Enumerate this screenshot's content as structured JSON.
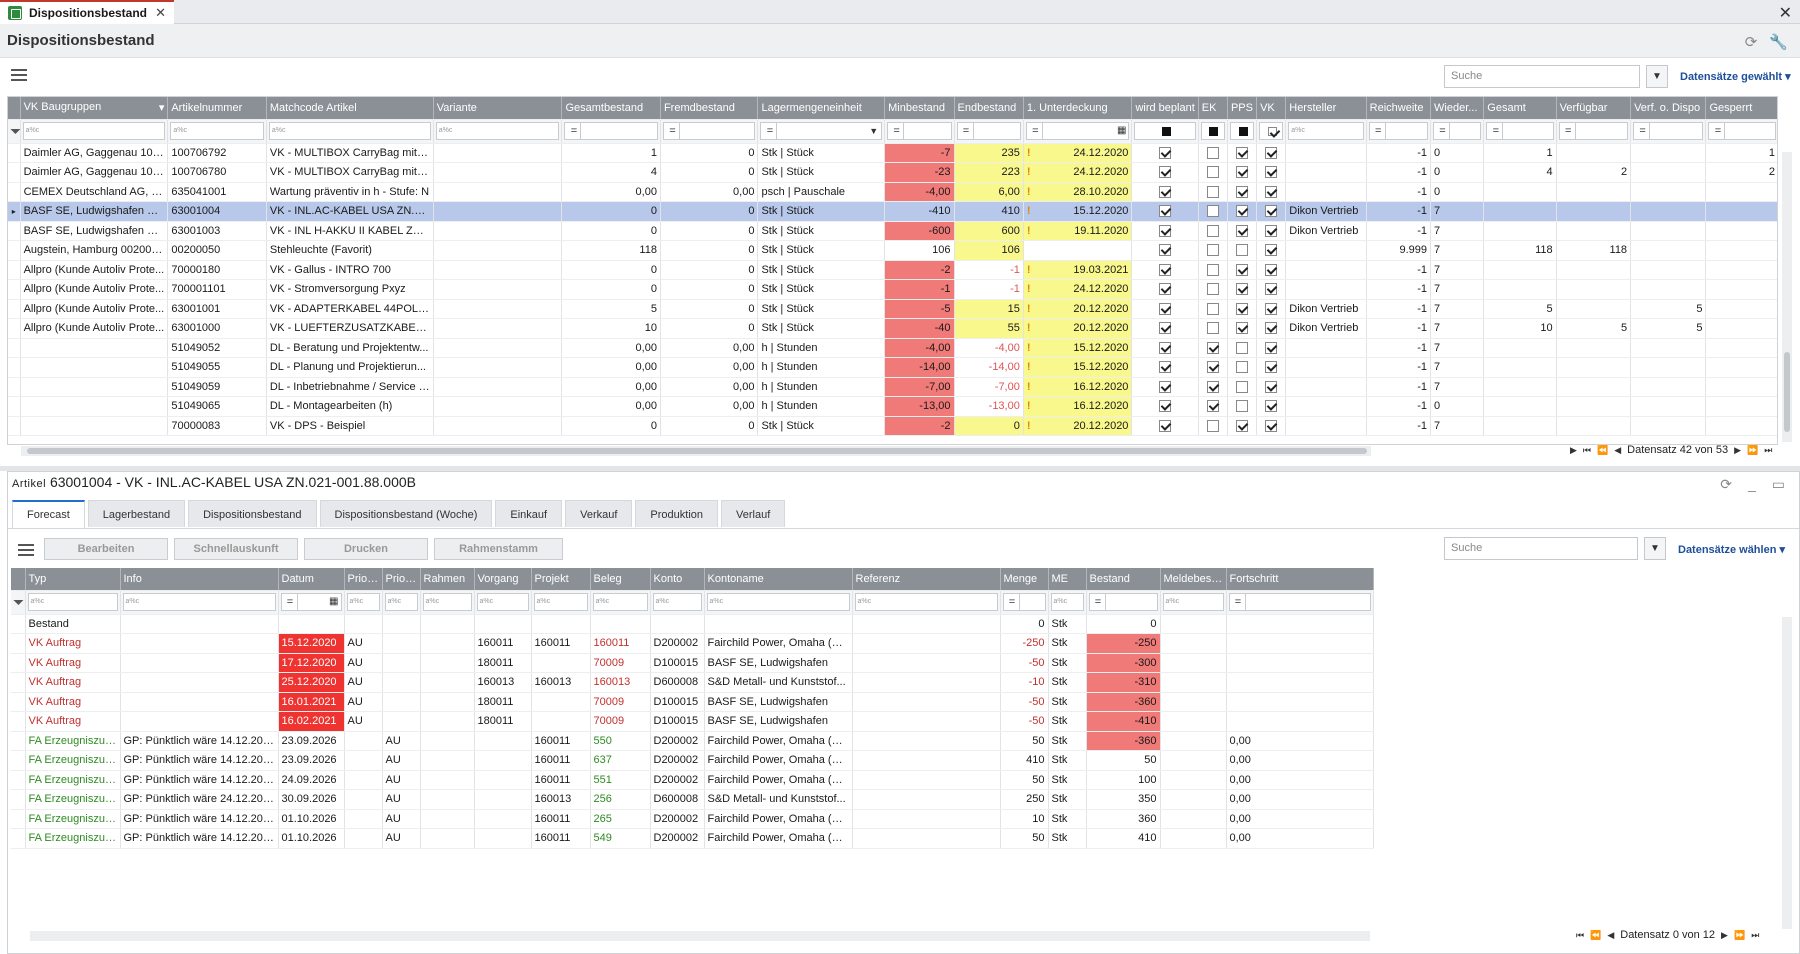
{
  "tab": {
    "label": "Dispositionsbestand",
    "close": "✕"
  },
  "window": {
    "title": "Dispositionsbestand",
    "close": "✕"
  },
  "top": {
    "search_placeholder": "Suche",
    "datasets_link": "Datensätze gewählt",
    "columns": [
      "VK Baugruppen",
      "Artikelnummer",
      "Matchcode Artikel",
      "Variante",
      "Gesamtbestand",
      "Fremdbestand",
      "Lagermengeneinheit",
      "Minbestand",
      "Endbestand",
      "1. Unterdeckung",
      "wird beplant",
      "EK",
      "PPS",
      "VK",
      "Hersteller",
      "Reichweite",
      "Wieder...",
      "Gesamt",
      "Verfügbar",
      "Verf. o. Dispo",
      "Gesperrt"
    ],
    "rows": [
      {
        "vk": "Daimler AG, Gaggenau 100...",
        "art": "100706792",
        "match": "VK - MULTIBOX CarryBag mit B...",
        "var": "",
        "ges": "1",
        "fremd": "0",
        "lme": "Stk  |  Stück",
        "min": "-7",
        "end": "235",
        "warn": "!",
        "unter": "24.12.2020",
        "wb": 1,
        "ek": 0,
        "pps": 1,
        "vkc": 1,
        "herst": "",
        "reich": "-1",
        "wied": "0",
        "gesamt": "1",
        "verf": "",
        "verfo": "",
        "gesp": "1",
        "minc": "red",
        "endc": "yellow",
        "unterc": "yellow"
      },
      {
        "vk": "Daimler AG, Gaggenau 100...",
        "art": "100706780",
        "match": "VK - MULTIBOX CarryBag mit B...",
        "var": "",
        "ges": "4",
        "fremd": "0",
        "lme": "Stk  |  Stück",
        "min": "-23",
        "end": "223",
        "warn": "!",
        "unter": "24.12.2020",
        "wb": 1,
        "ek": 0,
        "pps": 1,
        "vkc": 1,
        "herst": "",
        "reich": "-1",
        "wied": "0",
        "gesamt": "4",
        "verf": "2",
        "verfo": "",
        "gesp": "2",
        "minc": "red",
        "endc": "yellow",
        "unterc": "yellow"
      },
      {
        "vk": "CEMEX Deutschland AG, R...",
        "art": "635041001",
        "match": "Wartung präventiv in h - Stufe: N",
        "var": "",
        "ges": "0,00",
        "fremd": "0,00",
        "lme": "psch  |  Pauschale",
        "min": "-4,00",
        "end": "6,00",
        "warn": "!",
        "unter": "28.10.2020",
        "wb": 1,
        "ek": 0,
        "pps": 1,
        "vkc": 1,
        "herst": "",
        "reich": "-1",
        "wied": "0",
        "gesamt": "",
        "verf": "",
        "verfo": "",
        "gesp": "",
        "minc": "red",
        "endc": "yellow",
        "unterc": "yellow"
      },
      {
        "vk": "BASF SE, Ludwigshafen Fair...",
        "art": "63001004",
        "match": "VK - INL.AC-KABEL USA ZN.02...",
        "var": "",
        "ges": "0",
        "fremd": "0",
        "lme": "Stk  |  Stück",
        "min": "-410",
        "end": "410",
        "warn": "!",
        "unter": "15.12.2020",
        "wb": 1,
        "ek": 0,
        "pps": 1,
        "vkc": 1,
        "herst": "Dikon Vertrieb",
        "reich": "-1",
        "wied": "7",
        "gesamt": "",
        "verf": "",
        "verfo": "",
        "gesp": "",
        "sel": 1,
        "minc": "",
        "endc": "",
        "unterc": ""
      },
      {
        "vk": "BASF SE, Ludwigshafen Fair...",
        "art": "63001003",
        "match": "VK - INL H-AKKU II KABEL ZN.0...",
        "var": "",
        "ges": "0",
        "fremd": "0",
        "lme": "Stk  |  Stück",
        "min": "-600",
        "end": "600",
        "warn": "!",
        "unter": "19.11.2020",
        "wb": 1,
        "ek": 0,
        "pps": 1,
        "vkc": 1,
        "herst": "Dikon Vertrieb",
        "reich": "-1",
        "wied": "7",
        "gesamt": "",
        "verf": "",
        "verfo": "",
        "gesp": "",
        "minc": "red",
        "endc": "yellow",
        "unterc": "yellow"
      },
      {
        "vk": "Augstein, Hamburg 002000...",
        "art": "00200050",
        "match": "Stehleuchte  (Favorit)",
        "var": "",
        "ges": "118",
        "fremd": "0",
        "lme": "Stk  |  Stück",
        "min": "106",
        "end": "106",
        "warn": "",
        "unter": "",
        "wb": 1,
        "ek": 0,
        "pps": 0,
        "vkc": 1,
        "herst": "",
        "reich": "9.999",
        "wied": "7",
        "gesamt": "118",
        "verf": "118",
        "verfo": "",
        "gesp": "",
        "minc": "",
        "endc": "yellow",
        "unterc": ""
      },
      {
        "vk": "Allpro (Kunde Autoliv Prote...",
        "art": "70000180",
        "match": "VK - Gallus - INTRO 700",
        "var": "",
        "ges": "0",
        "fremd": "0",
        "lme": "Stk  |  Stück",
        "min": "-2",
        "end": "-1",
        "warn": "!",
        "unter": "19.03.2021",
        "wb": 1,
        "ek": 0,
        "pps": 1,
        "vkc": 1,
        "herst": "",
        "reich": "-1",
        "wied": "7",
        "gesamt": "",
        "verf": "",
        "verfo": "",
        "gesp": "",
        "minc": "red",
        "endc": "dim",
        "unterc": "yellow"
      },
      {
        "vk": "Allpro (Kunde Autoliv Prote...",
        "art": "700001101",
        "match": "VK - Stromversorgung Pxyz",
        "var": "",
        "ges": "0",
        "fremd": "0",
        "lme": "Stk  |  Stück",
        "min": "-1",
        "end": "-1",
        "warn": "!",
        "unter": "24.12.2020",
        "wb": 1,
        "ek": 0,
        "pps": 1,
        "vkc": 1,
        "herst": "",
        "reich": "-1",
        "wied": "7",
        "gesamt": "",
        "verf": "",
        "verfo": "",
        "gesp": "",
        "minc": "red",
        "endc": "dim",
        "unterc": "yellow"
      },
      {
        "vk": "Allpro (Kunde Autoliv Prote...",
        "art": "63001001",
        "match": "VK - ADAPTERKABEL 44POL2.5...",
        "var": "",
        "ges": "5",
        "fremd": "0",
        "lme": "Stk  |  Stück",
        "min": "-5",
        "end": "15",
        "warn": "!",
        "unter": "20.12.2020",
        "wb": 1,
        "ek": 0,
        "pps": 1,
        "vkc": 1,
        "herst": "Dikon Vertrieb",
        "reich": "-1",
        "wied": "7",
        "gesamt": "5",
        "verf": "",
        "verfo": "5",
        "gesp": "",
        "minc": "red",
        "endc": "yellow",
        "unterc": "yellow"
      },
      {
        "vk": "Allpro (Kunde Autoliv Prote...",
        "art": "63001000",
        "match": "VK - LUEFTERZUSATZKABEL KP...",
        "var": "",
        "ges": "10",
        "fremd": "0",
        "lme": "Stk  |  Stück",
        "min": "-40",
        "end": "55",
        "warn": "!",
        "unter": "20.12.2020",
        "wb": 1,
        "ek": 0,
        "pps": 1,
        "vkc": 1,
        "herst": "Dikon Vertrieb",
        "reich": "-1",
        "wied": "7",
        "gesamt": "10",
        "verf": "5",
        "verfo": "5",
        "gesp": "",
        "minc": "red",
        "endc": "yellow",
        "unterc": "yellow"
      },
      {
        "vk": "",
        "art": "51049052",
        "match": "DL - Beratung und Projektentw...",
        "var": "",
        "ges": "0,00",
        "fremd": "0,00",
        "lme": "h  |  Stunden",
        "min": "-4,00",
        "end": "-4,00",
        "warn": "!",
        "unter": "15.12.2020",
        "wb": 1,
        "ek": 1,
        "pps": 0,
        "vkc": 1,
        "herst": "",
        "reich": "-1",
        "wied": "7",
        "gesamt": "",
        "verf": "",
        "verfo": "",
        "gesp": "",
        "minc": "red",
        "endc": "dim",
        "unterc": "yellow"
      },
      {
        "vk": "",
        "art": "51049055",
        "match": "DL - Planung und Projektierun...",
        "var": "",
        "ges": "0,00",
        "fremd": "0,00",
        "lme": "h  |  Stunden",
        "min": "-14,00",
        "end": "-14,00",
        "warn": "!",
        "unter": "15.12.2020",
        "wb": 1,
        "ek": 1,
        "pps": 0,
        "vkc": 1,
        "herst": "",
        "reich": "-1",
        "wied": "7",
        "gesamt": "",
        "verf": "",
        "verfo": "",
        "gesp": "",
        "minc": "red",
        "endc": "dim",
        "unterc": "yellow"
      },
      {
        "vk": "",
        "art": "51049059",
        "match": "DL - Inbetriebnahme / Service (...",
        "var": "",
        "ges": "0,00",
        "fremd": "0,00",
        "lme": "h  |  Stunden",
        "min": "-7,00",
        "end": "-7,00",
        "warn": "!",
        "unter": "16.12.2020",
        "wb": 1,
        "ek": 1,
        "pps": 0,
        "vkc": 1,
        "herst": "",
        "reich": "-1",
        "wied": "7",
        "gesamt": "",
        "verf": "",
        "verfo": "",
        "gesp": "",
        "minc": "red",
        "endc": "dim",
        "unterc": "yellow"
      },
      {
        "vk": "",
        "art": "51049065",
        "match": "DL - Montagearbeiten (h)",
        "var": "",
        "ges": "0,00",
        "fremd": "0,00",
        "lme": "h  |  Stunden",
        "min": "-13,00",
        "end": "-13,00",
        "warn": "!",
        "unter": "16.12.2020",
        "wb": 1,
        "ek": 1,
        "pps": 0,
        "vkc": 1,
        "herst": "",
        "reich": "-1",
        "wied": "0",
        "gesamt": "",
        "verf": "",
        "verfo": "",
        "gesp": "",
        "minc": "red",
        "endc": "dim",
        "unterc": "yellow"
      },
      {
        "vk": "",
        "art": "70000083",
        "match": "VK - DPS - Beispiel",
        "var": "",
        "ges": "0",
        "fremd": "0",
        "lme": "Stk  |  Stück",
        "min": "-2",
        "end": "0",
        "warn": "!",
        "unter": "20.12.2020",
        "wb": 1,
        "ek": 0,
        "pps": 1,
        "vkc": 1,
        "herst": "",
        "reich": "-1",
        "wied": "7",
        "gesamt": "",
        "verf": "",
        "verfo": "",
        "gesp": "",
        "minc": "red",
        "endc": "yellow",
        "unterc": "yellow"
      }
    ],
    "pager": "Datensatz 42 von 53"
  },
  "lower": {
    "title_prefix": "Artikel",
    "title_rest": "63001004 - VK - INL.AC-KABEL USA ZN.021-001.88.000B",
    "tabs": [
      "Forecast",
      "Lagerbestand",
      "Dispositionsbestand",
      "Dispositionsbestand (Woche)",
      "Einkauf",
      "Verkauf",
      "Produktion",
      "Verlauf"
    ],
    "buttons": [
      "Bearbeiten",
      "Schnellauskunft",
      "Drucken",
      "Rahmenstamm"
    ],
    "search_placeholder": "Suche",
    "datasets_link": "Datensätze wählen",
    "columns": [
      "Typ",
      "Info",
      "Datum",
      "Prio. V",
      "Prio. E",
      "Rahmen",
      "Vorgang",
      "Projekt",
      "Beleg",
      "Konto",
      "Kontoname",
      "Referenz",
      "Menge",
      "ME",
      "Bestand",
      "Meldebest...",
      "Fortschritt"
    ],
    "rows": [
      {
        "typ": "Bestand",
        "info": "",
        "datum": "",
        "pv": "",
        "pe": "",
        "rahmen": "",
        "vorgang": "",
        "projekt": "",
        "beleg": "",
        "konto": "",
        "kname": "",
        "ref": "",
        "menge": "0",
        "me": "Stk",
        "bestand": "0",
        "melde": "",
        "fort": "",
        "kind": "plain",
        "dred": 0,
        "bred": 0
      },
      {
        "typ": "VK Auftrag",
        "info": "",
        "datum": "15.12.2020",
        "pv": "AU",
        "pe": "",
        "rahmen": "",
        "vorgang": "160011",
        "projekt": "160011",
        "beleg": "160011",
        "konto": "D200002",
        "kname": "Fairchild Power, Omaha (ni...",
        "ref": "",
        "menge": "-250",
        "me": "Stk",
        "bestand": "-250",
        "melde": "",
        "fort": "",
        "kind": "vk",
        "dred": 1,
        "bred": 1
      },
      {
        "typ": "VK Auftrag",
        "info": "",
        "datum": "17.12.2020",
        "pv": "AU",
        "pe": "",
        "rahmen": "",
        "vorgang": "180011",
        "projekt": "",
        "beleg": "70009",
        "konto": "D100015",
        "kname": "BASF SE, Ludwigshafen",
        "ref": "",
        "menge": "-50",
        "me": "Stk",
        "bestand": "-300",
        "melde": "",
        "fort": "",
        "kind": "vk",
        "dred": 1,
        "bred": 1
      },
      {
        "typ": "VK Auftrag",
        "info": "",
        "datum": "25.12.2020",
        "pv": "AU",
        "pe": "",
        "rahmen": "",
        "vorgang": "160013",
        "projekt": "160013",
        "beleg": "160013",
        "konto": "D600008",
        "kname": "S&D Metall- und Kunststof...",
        "ref": "",
        "menge": "-10",
        "me": "Stk",
        "bestand": "-310",
        "melde": "",
        "fort": "",
        "kind": "vk",
        "dred": 1,
        "bred": 1
      },
      {
        "typ": "VK Auftrag",
        "info": "",
        "datum": "16.01.2021",
        "pv": "AU",
        "pe": "",
        "rahmen": "",
        "vorgang": "180011",
        "projekt": "",
        "beleg": "70009",
        "konto": "D100015",
        "kname": "BASF SE, Ludwigshafen",
        "ref": "",
        "menge": "-50",
        "me": "Stk",
        "bestand": "-360",
        "melde": "",
        "fort": "",
        "kind": "vk",
        "dred": 1,
        "bred": 1
      },
      {
        "typ": "VK Auftrag",
        "info": "",
        "datum": "16.02.2021",
        "pv": "AU",
        "pe": "",
        "rahmen": "",
        "vorgang": "180011",
        "projekt": "",
        "beleg": "70009",
        "konto": "D100015",
        "kname": "BASF SE, Ludwigshafen",
        "ref": "",
        "menge": "-50",
        "me": "Stk",
        "bestand": "-410",
        "melde": "",
        "fort": "",
        "kind": "vk",
        "dred": 1,
        "bred": 1
      },
      {
        "typ": "FA Erzeugniszug...",
        "info": "GP: Pünktlich wäre 14.12.2020",
        "datum": "23.09.2026",
        "pv": "",
        "pe": "AU",
        "rahmen": "",
        "vorgang": "",
        "projekt": "160011",
        "beleg": "550",
        "konto": "D200002",
        "kname": "Fairchild Power, Omaha (ni...",
        "ref": "",
        "menge": "50",
        "me": "Stk",
        "bestand": "-360",
        "melde": "",
        "fort": "0,00",
        "kind": "fa",
        "dred": 0,
        "bred": 1
      },
      {
        "typ": "FA Erzeugniszug...",
        "info": "GP: Pünktlich wäre 14.12.2020",
        "datum": "23.09.2026",
        "pv": "",
        "pe": "AU",
        "rahmen": "",
        "vorgang": "",
        "projekt": "160011",
        "beleg": "637",
        "konto": "D200002",
        "kname": "Fairchild Power, Omaha (ni...",
        "ref": "",
        "menge": "410",
        "me": "Stk",
        "bestand": "50",
        "melde": "",
        "fort": "0,00",
        "kind": "fa",
        "dred": 0,
        "bred": 0
      },
      {
        "typ": "FA Erzeugniszug...",
        "info": "GP: Pünktlich wäre 14.12.2020",
        "datum": "24.09.2026",
        "pv": "",
        "pe": "AU",
        "rahmen": "",
        "vorgang": "",
        "projekt": "160011",
        "beleg": "551",
        "konto": "D200002",
        "kname": "Fairchild Power, Omaha (ni...",
        "ref": "",
        "menge": "50",
        "me": "Stk",
        "bestand": "100",
        "melde": "",
        "fort": "0,00",
        "kind": "fa",
        "dred": 0,
        "bred": 0
      },
      {
        "typ": "FA Erzeugniszug...",
        "info": "GP: Pünktlich wäre 24.12.2020",
        "datum": "30.09.2026",
        "pv": "",
        "pe": "AU",
        "rahmen": "",
        "vorgang": "",
        "projekt": "160013",
        "beleg": "256",
        "konto": "D600008",
        "kname": "S&D Metall- und Kunststof...",
        "ref": "",
        "menge": "250",
        "me": "Stk",
        "bestand": "350",
        "melde": "",
        "fort": "0,00",
        "kind": "fa",
        "dred": 0,
        "bred": 0
      },
      {
        "typ": "FA Erzeugniszug...",
        "info": "GP: Pünktlich wäre 14.12.2020",
        "datum": "01.10.2026",
        "pv": "",
        "pe": "AU",
        "rahmen": "",
        "vorgang": "",
        "projekt": "160011",
        "beleg": "265",
        "konto": "D200002",
        "kname": "Fairchild Power, Omaha (ni...",
        "ref": "",
        "menge": "10",
        "me": "Stk",
        "bestand": "360",
        "melde": "",
        "fort": "0,00",
        "kind": "fa",
        "dred": 0,
        "bred": 0
      },
      {
        "typ": "FA Erzeugniszug...",
        "info": "GP: Pünktlich wäre 14.12.2020",
        "datum": "01.10.2026",
        "pv": "",
        "pe": "AU",
        "rahmen": "",
        "vorgang": "",
        "projekt": "160011",
        "beleg": "549",
        "konto": "D200002",
        "kname": "Fairchild Power, Omaha (ni...",
        "ref": "",
        "menge": "50",
        "me": "Stk",
        "bestand": "410",
        "melde": "",
        "fort": "0,00",
        "kind": "fa",
        "dred": 0,
        "bred": 0
      }
    ],
    "pager": "Datensatz 0 von 12"
  }
}
